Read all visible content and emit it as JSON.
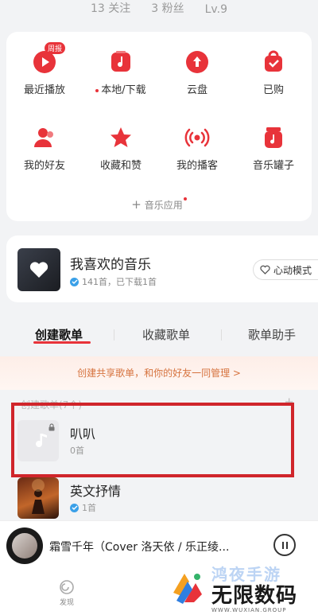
{
  "header": {
    "stats": [
      "13 关注",
      "3 粉丝",
      "Lv.9"
    ]
  },
  "quick_access": {
    "items": [
      {
        "label": "最近播放",
        "icon": "play-icon",
        "badge": "周报"
      },
      {
        "label": "本地/下载",
        "icon": "music-note-icon",
        "dot": true
      },
      {
        "label": "云盘",
        "icon": "cloud-upload-icon"
      },
      {
        "label": "已购",
        "icon": "shopping-bag-icon"
      },
      {
        "label": "我的好友",
        "icon": "friends-icon"
      },
      {
        "label": "收藏和赞",
        "icon": "star-icon"
      },
      {
        "label": "我的播客",
        "icon": "broadcast-icon"
      },
      {
        "label": "音乐罐子",
        "icon": "music-jar-icon"
      }
    ],
    "apps_label": "音乐应用"
  },
  "liked": {
    "title": "我喜欢的音乐",
    "subtitle": "141首，已下载1首",
    "mode_button": "心动模式"
  },
  "tabs": [
    "创建歌单",
    "收藏歌单",
    "歌单助手"
  ],
  "share_banner": "创建共享歌单，和你的好友一同管理 >",
  "list_header": "创建歌单(7个)",
  "playlists": [
    {
      "title": "叭叭",
      "subtitle": "0首"
    },
    {
      "title": "英文抒情",
      "subtitle": "1首"
    }
  ],
  "player": {
    "title": "霜雪千年（Cover 洛天依 / 乐正绫..."
  },
  "bottom_nav": {
    "discover": "发现"
  },
  "watermark": {
    "top": "鸿夜手游",
    "main": "无限数码",
    "url": "WWW.WUXIAN.GROUP"
  },
  "colors": {
    "accent": "#e8333a",
    "highlight": "#d0252b"
  }
}
